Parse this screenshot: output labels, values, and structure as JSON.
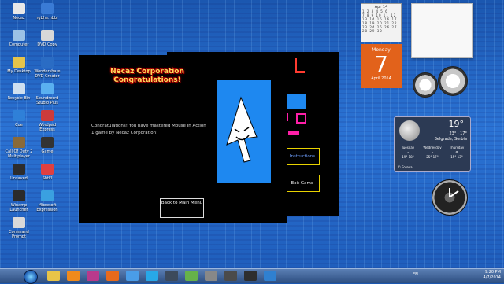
{
  "desktop": {
    "icons": [
      {
        "label": "Necaz",
        "color": "#e8e8e8"
      },
      {
        "label": "rgbhe.hbbl",
        "color": "#3a7bd5"
      },
      {
        "label": "Computer",
        "color": "#9bc2e6"
      },
      {
        "label": "DVD Copy",
        "color": "#d8d8d8"
      },
      {
        "label": "My Desktop",
        "color": "#e6c44a"
      },
      {
        "label": "Wondershare DVD Creator",
        "color": "#2a6cc4"
      },
      {
        "label": "Recycle Bin",
        "color": "#cfe0f0"
      },
      {
        "label": "Soundrecrd Studio Plus",
        "color": "#5ab0f0"
      },
      {
        "label": "Cue",
        "color": "#2f80d8"
      },
      {
        "label": "Wordpad Express",
        "color": "#cc3b3b"
      },
      {
        "label": "Call Of Duty 2 Multiplayer",
        "color": "#8a6a3a"
      },
      {
        "label": "Game",
        "color": "#333333"
      },
      {
        "label": "Unsaved",
        "color": "#2d2d2d"
      },
      {
        "label": "ShtFl",
        "color": "#e04040"
      },
      {
        "label": "Winamp Launcher",
        "color": "#2b2b2b"
      },
      {
        "label": "Microsoft Expression",
        "color": "#3aa0e0"
      },
      {
        "label": "Command Prompt",
        "color": "#d9d9d9"
      }
    ]
  },
  "gadgets": {
    "calendar": {
      "month_header": "Apr 14",
      "weekday": "Monday",
      "day": "7",
      "month_year": "April 2014"
    },
    "weather": {
      "temp": "19°",
      "hilo": "23° · 17°",
      "location": "Belgrade, Serbia",
      "forecast": [
        {
          "day": "Tuesday",
          "temp": "19° 18°"
        },
        {
          "day": "Wednesday",
          "temp": "25° 17°"
        },
        {
          "day": "Thursday",
          "temp": "15° 13°"
        }
      ],
      "source": "© Foreca"
    }
  },
  "game": {
    "logo_line1": "Necaz Corporation",
    "logo_line2": "Congratulations!",
    "message": "Congratulations! You have mastered Mouse In Action 1 game by Necaz Corporation!",
    "back_button": "Back to Main Menu",
    "instructions_button": "Instructions",
    "exit_button": "Exit Game"
  },
  "taskbar": {
    "apps": [
      {
        "name": "explorer-icon",
        "color": "#e8c448"
      },
      {
        "name": "media-player-icon",
        "color": "#f08a1c"
      },
      {
        "name": "winrar-icon",
        "color": "#b83a8c"
      },
      {
        "name": "firefox-icon",
        "color": "#e86a1c"
      },
      {
        "name": "chrome-icon",
        "color": "#4a9de8"
      },
      {
        "name": "skype-icon",
        "color": "#27a8e8"
      },
      {
        "name": "steam-icon",
        "color": "#3c4a5c"
      },
      {
        "name": "paint-icon",
        "color": "#66b24a"
      },
      {
        "name": "terminal-icon",
        "color": "#888888"
      },
      {
        "name": "game-icon",
        "color": "#4b4b4b"
      },
      {
        "name": "game2-icon",
        "color": "#2e2e2e"
      },
      {
        "name": "globe-icon",
        "color": "#3080d0"
      }
    ],
    "lang": "EN",
    "time": "9:20 PM",
    "date": "4/7/2014"
  }
}
